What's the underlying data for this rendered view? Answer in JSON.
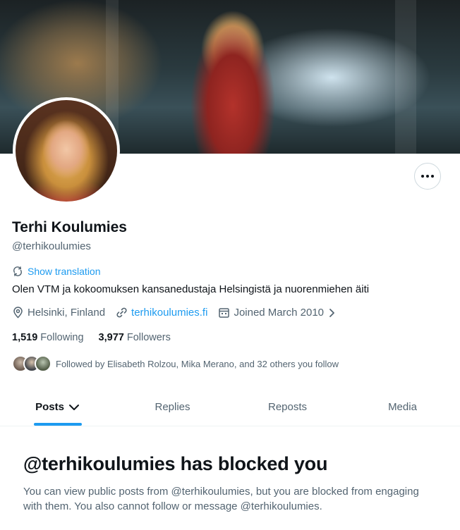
{
  "profile": {
    "name": "Terhi Koulumies",
    "handle": "@terhikoulumies",
    "show_translation": "Show translation",
    "bio": "Olen VTM ja kokoomuksen kansanedustaja Helsingistä ja nuorenmiehen äiti",
    "location": "Helsinki, Finland",
    "website": "terhikoulumies.fi",
    "joined": "Joined March 2010"
  },
  "stats": {
    "following_count": "1,519",
    "following_label": "Following",
    "followers_count": "3,977",
    "followers_label": "Followers"
  },
  "followed_by": "Followed by Elisabeth Rolzou, Mika Merano, and 32 others you follow",
  "tabs": [
    {
      "label": "Posts",
      "active": true
    },
    {
      "label": "Replies"
    },
    {
      "label": "Reposts"
    },
    {
      "label": "Media"
    }
  ],
  "blocked": {
    "title": "@terhikoulumies has blocked you",
    "text": "You can view public posts from @terhikoulumies, but you are blocked from engaging with them. You also cannot follow or message @terhikoulumies."
  },
  "icons": {
    "more": "more-horizontal-icon",
    "translate": "translate-icon",
    "location": "location-pin-icon",
    "link": "link-icon",
    "calendar": "calendar-icon",
    "chevron": "chevron-right-icon",
    "dropdown": "chevron-down-icon"
  },
  "colors": {
    "accent": "#1d9bf0",
    "text_primary": "#0f1419",
    "text_secondary": "#536471"
  }
}
